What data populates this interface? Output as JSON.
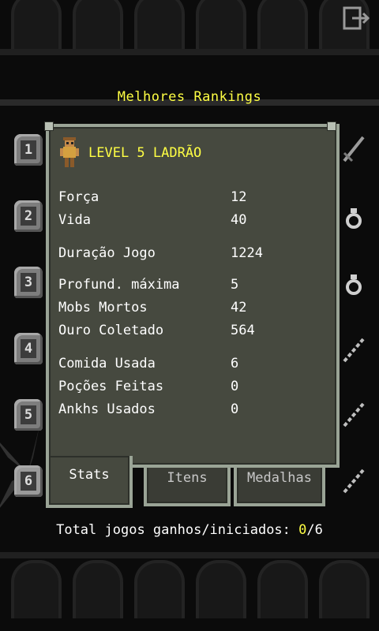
{
  "header": {
    "title": "Melhores Rankings",
    "exit_icon": "exit-door-icon"
  },
  "rankings": [
    {
      "rank": "1",
      "icon": "sword-icon"
    },
    {
      "rank": "2",
      "icon": "ring-icon"
    },
    {
      "rank": "3",
      "icon": "ring-icon"
    },
    {
      "rank": "4",
      "icon": "wand-icon"
    },
    {
      "rank": "5",
      "icon": "wand-icon"
    },
    {
      "rank": "6",
      "icon": "wand-icon"
    }
  ],
  "details": {
    "hero_title": "LEVEL 5 LADRÃO",
    "hero_icon": "rogue-hero-icon",
    "stats": [
      {
        "label": "Força",
        "value": "12"
      },
      {
        "label": "Vida",
        "value": "40"
      },
      {
        "label": "Duração Jogo",
        "value": "1224"
      },
      {
        "label": "Profund. máxima",
        "value": "5"
      },
      {
        "label": "Mobs Mortos",
        "value": "42"
      },
      {
        "label": "Ouro Coletado",
        "value": "564"
      },
      {
        "label": "Comida Usada",
        "value": "6"
      },
      {
        "label": "Poções Feitas",
        "value": "0"
      },
      {
        "label": "Ankhs Usados",
        "value": "0"
      }
    ],
    "tabs": [
      {
        "label": "Stats",
        "active": true
      },
      {
        "label": "Itens",
        "active": false
      },
      {
        "label": "Medalhas",
        "active": false
      }
    ]
  },
  "footer": {
    "text": "Total jogos ganhos/iniciados: ",
    "won": "0",
    "sep": "/",
    "started": "6"
  },
  "colors": {
    "accent": "#ffff44",
    "panel": "#46493f",
    "border": "#9aa496"
  }
}
